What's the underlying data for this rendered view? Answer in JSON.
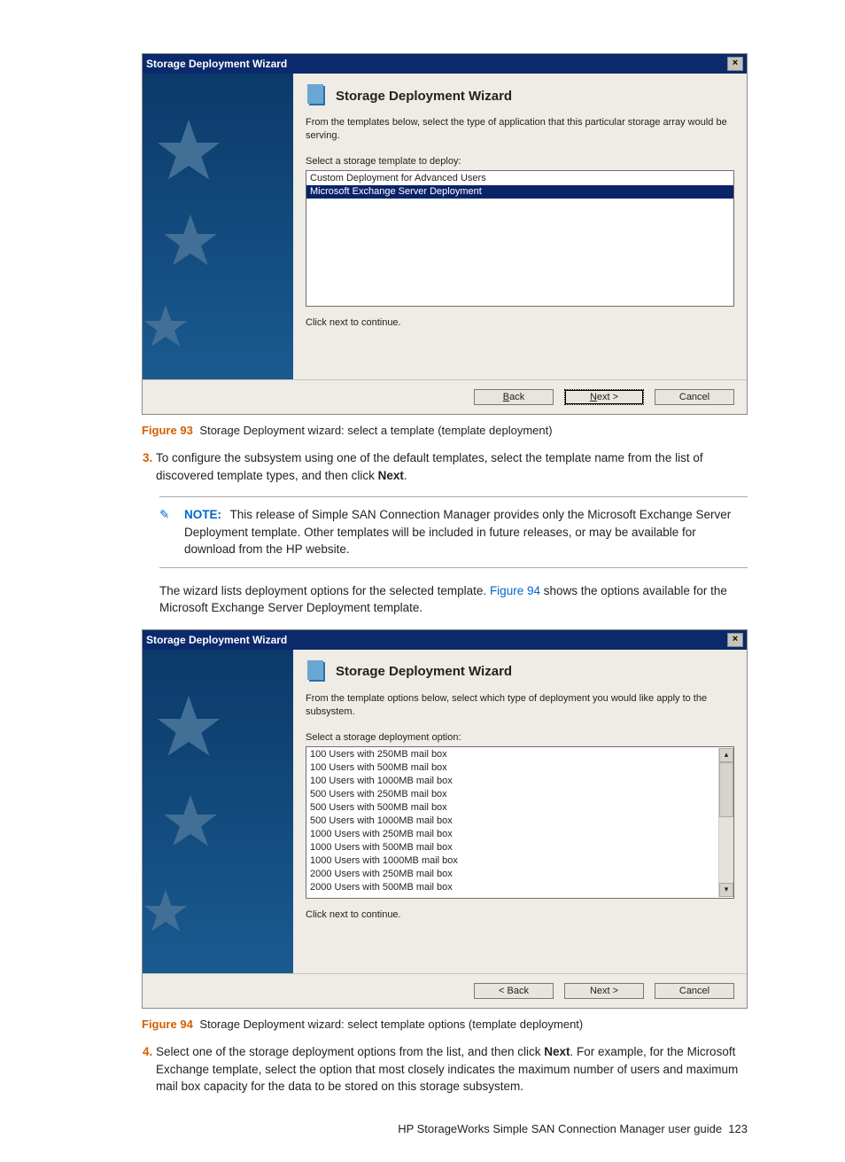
{
  "wizard1": {
    "title": "Storage Deployment Wizard",
    "heading": "Storage Deployment Wizard",
    "desc": "From the templates below, select the type of application that this particular storage array would be serving.",
    "subhead": "Select a storage template to deploy:",
    "items": [
      {
        "label": "Custom Deployment for Advanced Users",
        "selected": false
      },
      {
        "label": "Microsoft Exchange Server Deployment",
        "selected": true
      }
    ],
    "continue": "Click next to continue.",
    "back": "< Back",
    "next": "Next >",
    "cancel": "Cancel"
  },
  "caption1": {
    "label": "Figure 93",
    "text": "Storage Deployment wizard: select a template (template deployment)"
  },
  "step3": {
    "num": "3.",
    "text_a": "To configure the subsystem using one of the default templates, select the template name from the list of discovered template types, and then click ",
    "bold": "Next",
    "text_b": "."
  },
  "note": {
    "label": "NOTE:",
    "text": "This release of Simple SAN Connection Manager provides only the Microsoft Exchange Server Deployment template. Other templates will be included in future releases, or may be available for download from the HP website."
  },
  "para1": {
    "a": "The wizard lists deployment options for the selected template. ",
    "link": "Figure 94",
    "b": " shows the options available for the Microsoft Exchange Server Deployment template."
  },
  "wizard2": {
    "title": "Storage Deployment Wizard",
    "heading": "Storage Deployment Wizard",
    "desc": "From the template options below, select which type of deployment you would like apply to the subsystem.",
    "subhead": "Select a storage deployment option:",
    "items": [
      "100 Users with 250MB mail box",
      "100 Users with 500MB mail box",
      "100 Users with 1000MB mail box",
      "500 Users with 250MB mail box",
      "500 Users with 500MB mail box",
      "500 Users with 1000MB mail box",
      "1000 Users with 250MB mail box",
      "1000 Users with 500MB mail box",
      "1000 Users with 1000MB mail box",
      "2000 Users with 250MB mail box",
      "2000 Users with 500MB mail box"
    ],
    "continue": "Click next to continue.",
    "back": "< Back",
    "next": "Next >",
    "cancel": "Cancel"
  },
  "caption2": {
    "label": "Figure 94",
    "text": "Storage Deployment wizard: select template options (template deployment)"
  },
  "step4": {
    "num": "4.",
    "text_a": "Select one of the storage deployment options from the list, and then click ",
    "bold": "Next",
    "text_b": ". For example, for the Microsoft Exchange template, select the option that most closely indicates the maximum number of users and maximum mail box capacity for the data to be stored on this storage subsystem."
  },
  "footer": {
    "text": "HP StorageWorks Simple SAN Connection Manager user guide",
    "page": "123"
  }
}
